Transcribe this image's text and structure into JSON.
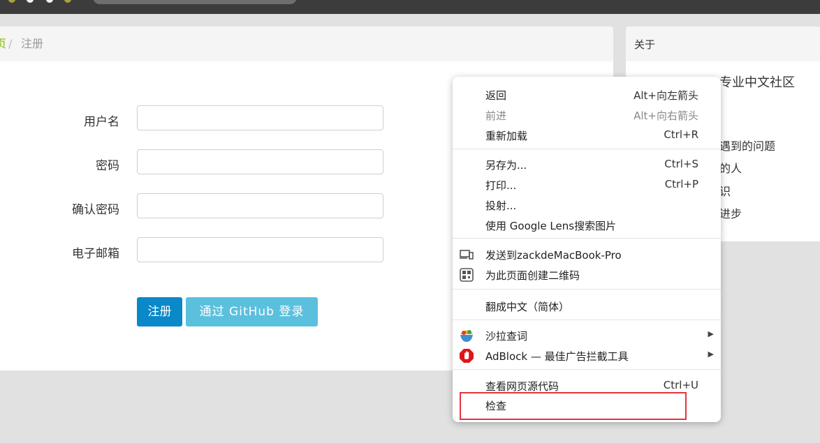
{
  "breadcrumb": {
    "home": "页",
    "separator": "/",
    "current": "注册"
  },
  "form": {
    "username_label": "用户名",
    "password_label": "密码",
    "confirm_password_label": "确认密码",
    "email_label": "电子邮箱",
    "username_value": "",
    "password_value": "",
    "confirm_password_value": "",
    "email_value": ""
  },
  "buttons": {
    "register": "注册",
    "github_login": "通过 GitHub 登录"
  },
  "sidebar": {
    "header": "关于",
    "title_fragment": "专业中文社区",
    "items": [
      "遇到的问题",
      "的人",
      "识",
      "进步"
    ]
  },
  "context_menu": {
    "back": {
      "label": "返回",
      "shortcut": "Alt+向左箭头"
    },
    "forward": {
      "label": "前进",
      "shortcut": "Alt+向右箭头"
    },
    "reload": {
      "label": "重新加载",
      "shortcut": "Ctrl+R"
    },
    "save_as": {
      "label": "另存为...",
      "shortcut": "Ctrl+S"
    },
    "print": {
      "label": "打印...",
      "shortcut": "Ctrl+P"
    },
    "cast": {
      "label": "投射..."
    },
    "lens": {
      "label": "使用 Google Lens搜索图片"
    },
    "send_to_device": {
      "label": "发送到zackdeMacBook-Pro",
      "icon": "devices-icon"
    },
    "qr_code": {
      "label": "为此页面创建二维码",
      "icon": "qr-code-icon"
    },
    "translate": {
      "label": "翻成中文（简体）"
    },
    "salad_dict": {
      "label": "沙拉查词",
      "icon": "salad-dict-icon"
    },
    "adblock": {
      "label": "AdBlock — 最佳广告拦截工具",
      "icon": "adblock-icon"
    },
    "view_source": {
      "label": "查看网页源代码",
      "shortcut": "Ctrl+U"
    },
    "inspect": {
      "label": "检查"
    }
  },
  "colors": {
    "accent_blue": "#0a88c8",
    "github_button": "#5bc0de",
    "breadcrumb_home": "#80bd01",
    "highlight_red": "#e5323f"
  }
}
